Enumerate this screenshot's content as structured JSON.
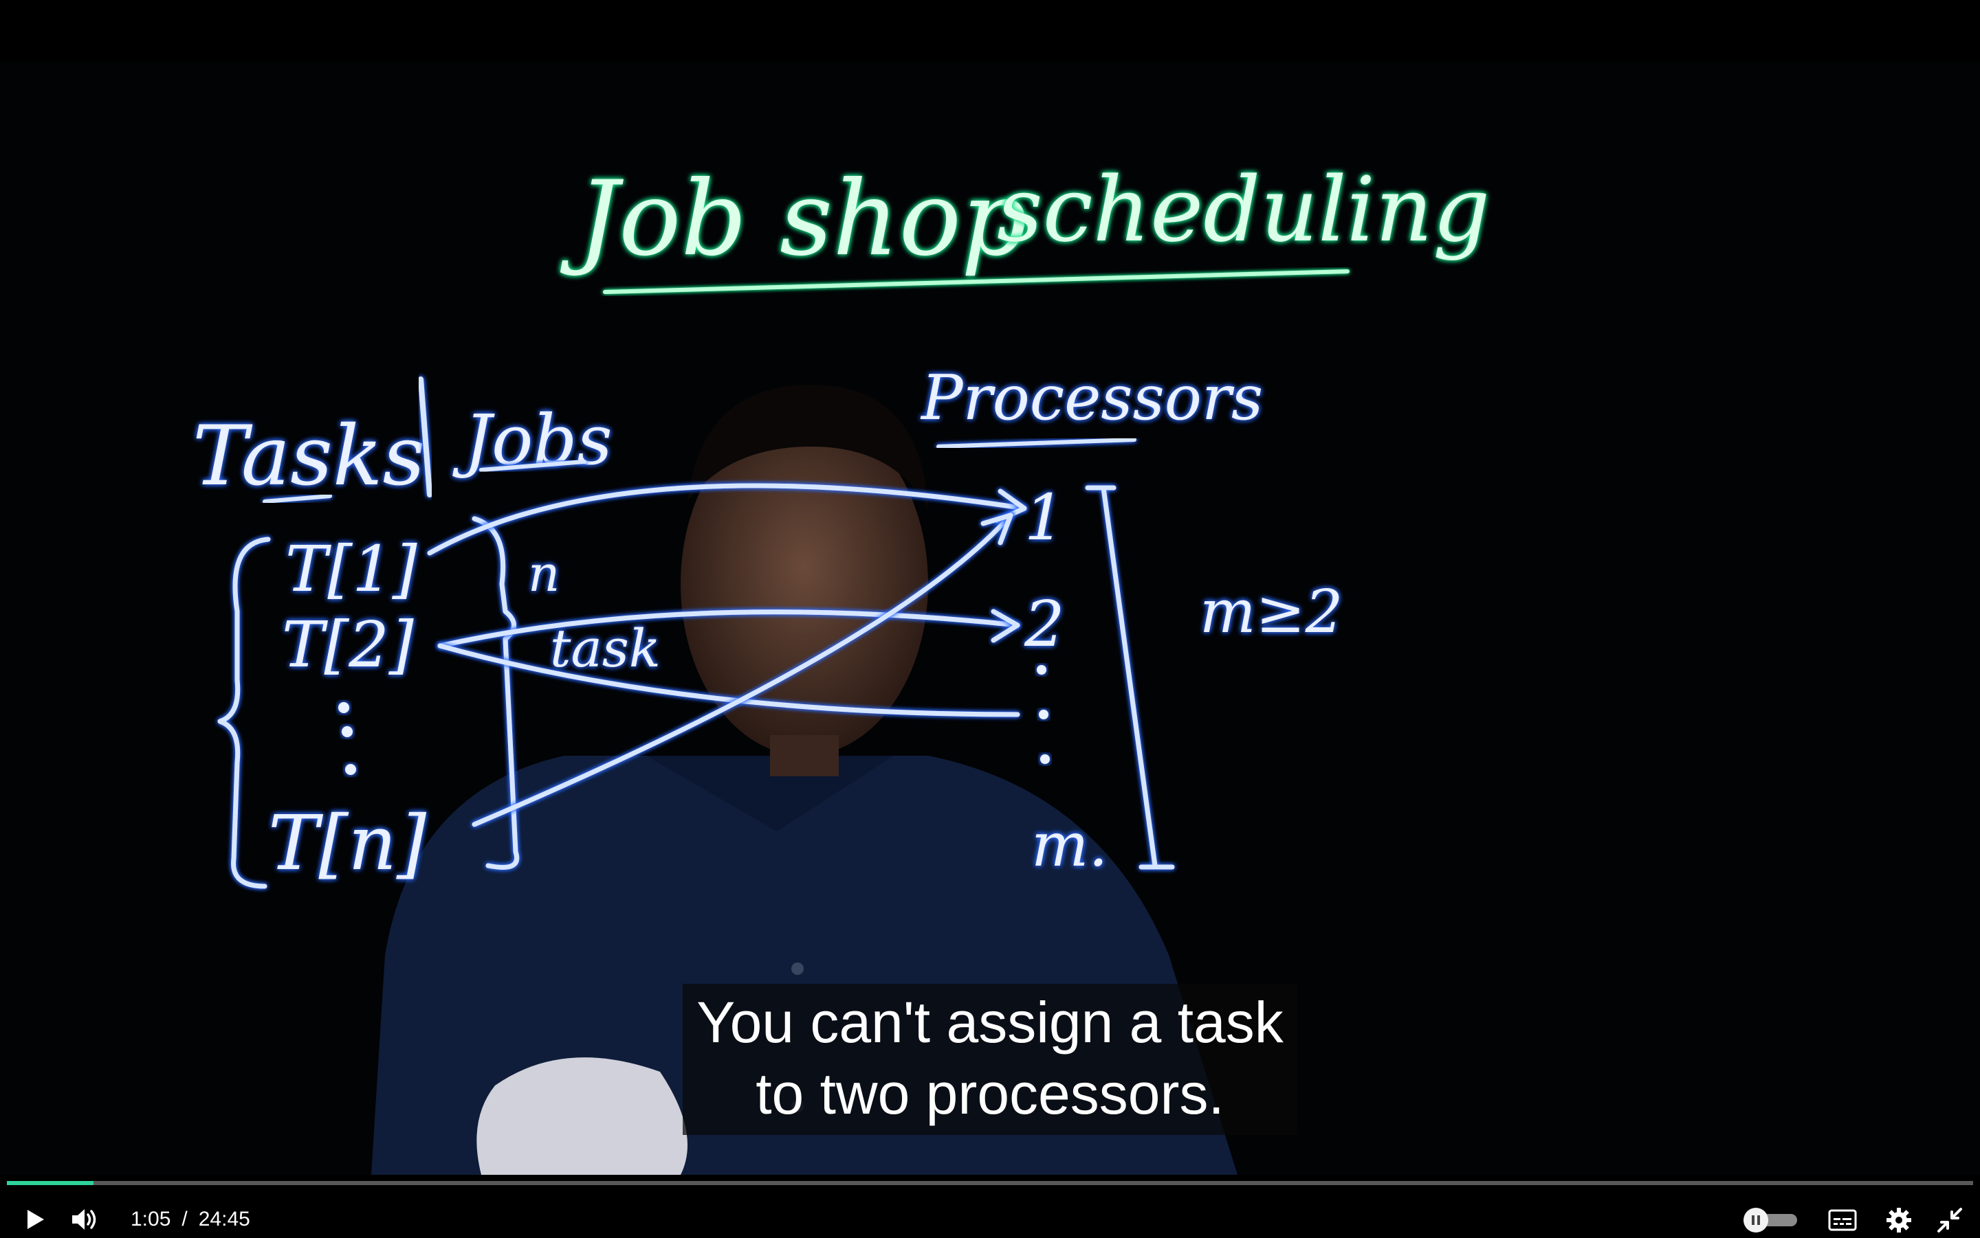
{
  "video": {
    "board": {
      "title_job_shop": "Job shop",
      "title_scheduling": "scheduling",
      "tasks_label": "Tasks",
      "jobs_label": "Jobs",
      "processors_label": "Processors",
      "task_items": [
        "T[1]",
        "T[2]",
        "T[n]"
      ],
      "n_brace_label": "n",
      "task_word": "task",
      "processor_items": [
        "1",
        "2",
        "m."
      ],
      "constraint": "m≥2"
    },
    "progress_percent": 4.4
  },
  "captions": {
    "line1": "You can't assign a task",
    "line2": "to two processors."
  },
  "controls": {
    "current_time": "1:05",
    "separator": "/",
    "duration": "24:45",
    "icons": {
      "play": "play-icon",
      "volume": "volume-icon",
      "autoplay": "autoplay-toggle-icon",
      "cc": "closed-captions-icon",
      "settings": "gear-icon",
      "fullscreen": "exit-fullscreen-icon"
    },
    "colors": {
      "progress": "#2fd39a",
      "chalk_green": "#b8ffd6",
      "chalk_blue": "#d7e6ff"
    }
  }
}
